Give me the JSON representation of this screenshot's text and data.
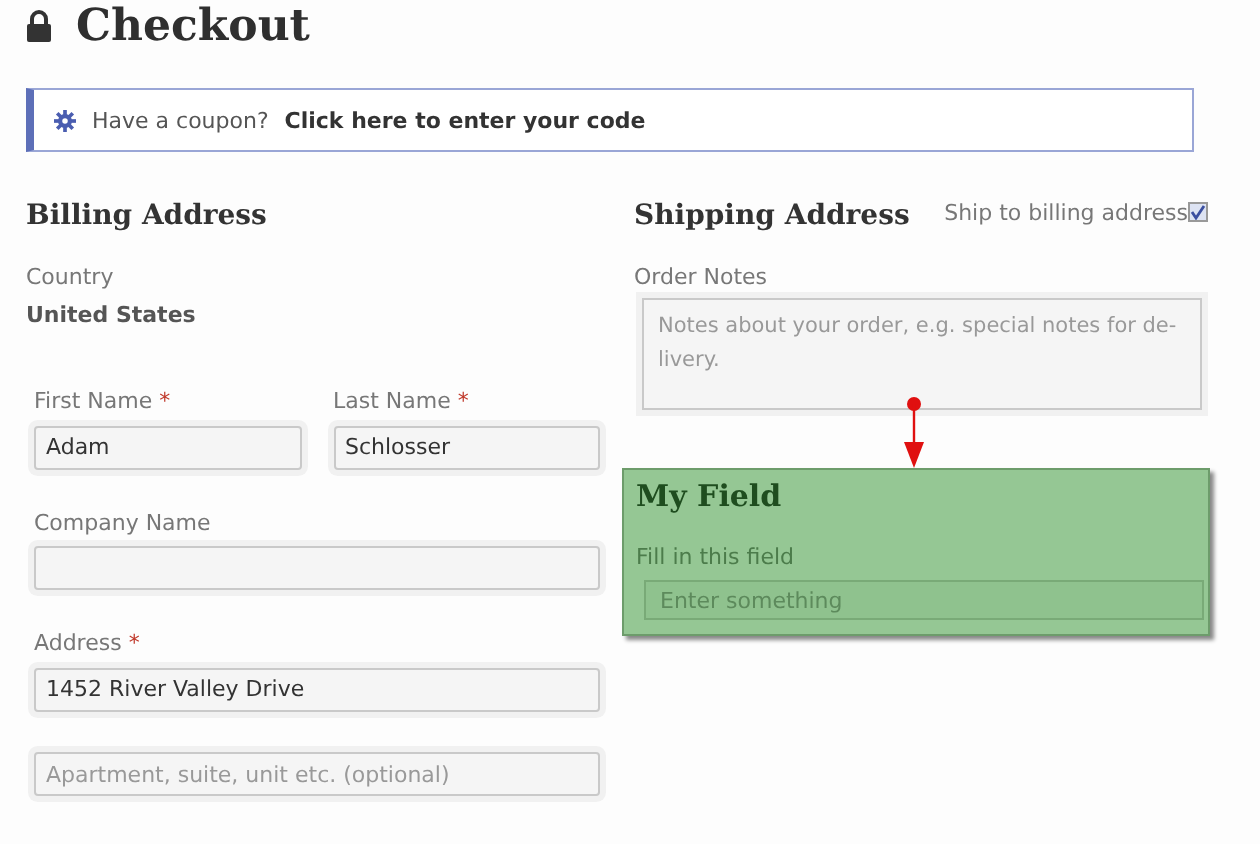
{
  "title": "Checkout",
  "coupon": {
    "text": "Have a coupon?",
    "link": "Click here to enter your code"
  },
  "billing": {
    "heading": "Billing Address",
    "country": {
      "label": "Country",
      "value": "United States"
    },
    "fields": [
      {
        "kind": "half",
        "label": "First Name",
        "required_mark": "*",
        "value": "Adam"
      },
      {
        "kind": "half",
        "label": "Last Name",
        "required_mark": "*",
        "value": "Schlosser"
      },
      {
        "kind": "full",
        "label": "Company Name"
      },
      {
        "kind": "full",
        "label": "Address",
        "required_mark": "*",
        "value": "1452 River Valley Drive"
      },
      {
        "kind": "full",
        "placeholder": "Apartment, suite, unit etc. (optional)"
      }
    ]
  },
  "shipping": {
    "heading": "Shipping Address",
    "ship_to_billing": {
      "label": "Ship to billing address",
      "checked": true
    },
    "order_notes": {
      "label": "Order Notes",
      "placeholder": "Notes about your order, e.g. special notes for de-livery."
    }
  },
  "custom_field": {
    "title": "My Field",
    "label": "Fill in this field",
    "placeholder": "Enter something"
  }
}
